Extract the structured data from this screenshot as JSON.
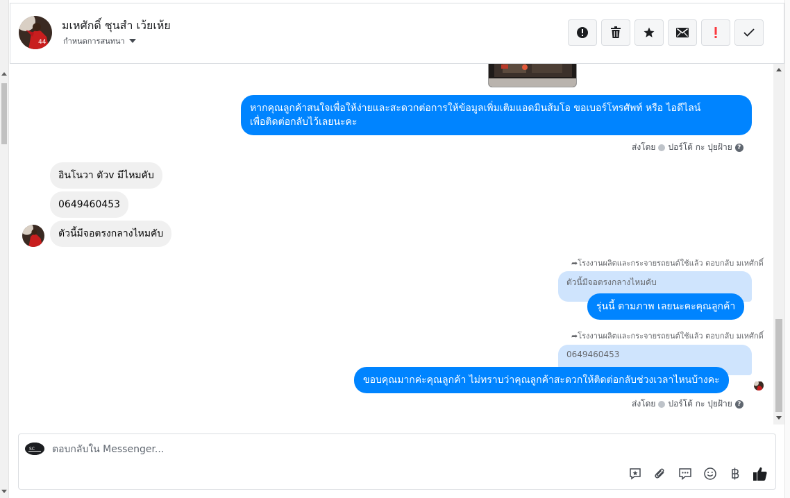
{
  "header": {
    "contact_name": "มเหศักดิ์ ชุนสำ เว้ยเห้ย",
    "assign_label": "กำหนดการสนทนา",
    "toolbar": [
      "spam-icon",
      "trash-icon",
      "star-icon",
      "mail-icon",
      "important-icon",
      "done-icon"
    ]
  },
  "messages": {
    "out_1": "หากคุณลูกค้าสนใจเพื่อให้ง่ายและสะดวกต่อการให้ข้อมูลเพิ่มเติมแอดมินส้มโอ ขอเบอร์โทรศัพท์ หรือ ไอดีไลน์",
    "out_1_line2": "เพื่อติดต่อกลับไว้เลยนะคะ",
    "sent_by_1": "ส่งโดย",
    "sender_1": "ปอร์โต้ กะ ปุยฝ้าย",
    "in_1": "อินโนวา ตัวv มีไหมคับ",
    "in_2": "0649460453",
    "in_3": "ตัวนี้มีจอตรงกลางไหมคับ",
    "reply_note_1": "โรงงานผลิตและกระจายรถยนต์ใช้แล้ว ตอบกลับ มเหศักดิ์",
    "quote_1": "ตัวนี้มีจอตรงกลางไหมคับ",
    "out_2": "รุ่นนี้ ตามภาพ  เลยนะคะคุณลูกค้า",
    "reply_note_2": "โรงงานผลิตและกระจายรถยนต์ใช้แล้ว ตอบกลับ มเหศักดิ์",
    "quote_2": "0649460453",
    "out_3": "ขอบคุณมากค่ะคุณลูกค้า ไม่ทราบว่าคุณลูกค้าสะดวกให้ติดต่อกลับช่วงเวลาไหนบ้างคะ",
    "sent_by_2": "ส่งโดย",
    "sender_2": "ปอร์โต้ กะ ปุยฝ้าย"
  },
  "composer": {
    "placeholder": "ตอบกลับใน Messenger...",
    "icons": [
      "saved-reply-icon",
      "attachment-icon",
      "chat-icon",
      "emoji-icon",
      "baht-icon",
      "like-icon"
    ]
  },
  "colors": {
    "outgoing": "#0084ff",
    "incoming": "#f0f0f0",
    "quote": "#cfe4fd"
  }
}
